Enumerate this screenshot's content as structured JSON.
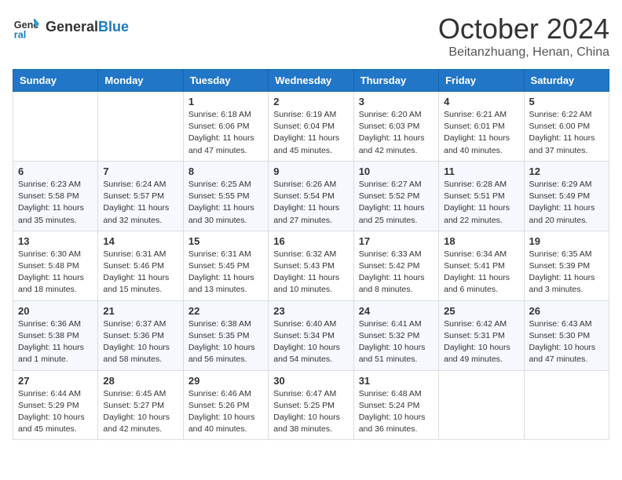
{
  "header": {
    "logo_general": "General",
    "logo_blue": "Blue",
    "month_title": "October 2024",
    "location": "Beitanzhuang, Henan, China"
  },
  "weekdays": [
    "Sunday",
    "Monday",
    "Tuesday",
    "Wednesday",
    "Thursday",
    "Friday",
    "Saturday"
  ],
  "weeks": [
    [
      {
        "day": "",
        "info": ""
      },
      {
        "day": "",
        "info": ""
      },
      {
        "day": "1",
        "info": "Sunrise: 6:18 AM\nSunset: 6:06 PM\nDaylight: 11 hours and 47 minutes."
      },
      {
        "day": "2",
        "info": "Sunrise: 6:19 AM\nSunset: 6:04 PM\nDaylight: 11 hours and 45 minutes."
      },
      {
        "day": "3",
        "info": "Sunrise: 6:20 AM\nSunset: 6:03 PM\nDaylight: 11 hours and 42 minutes."
      },
      {
        "day": "4",
        "info": "Sunrise: 6:21 AM\nSunset: 6:01 PM\nDaylight: 11 hours and 40 minutes."
      },
      {
        "day": "5",
        "info": "Sunrise: 6:22 AM\nSunset: 6:00 PM\nDaylight: 11 hours and 37 minutes."
      }
    ],
    [
      {
        "day": "6",
        "info": "Sunrise: 6:23 AM\nSunset: 5:58 PM\nDaylight: 11 hours and 35 minutes."
      },
      {
        "day": "7",
        "info": "Sunrise: 6:24 AM\nSunset: 5:57 PM\nDaylight: 11 hours and 32 minutes."
      },
      {
        "day": "8",
        "info": "Sunrise: 6:25 AM\nSunset: 5:55 PM\nDaylight: 11 hours and 30 minutes."
      },
      {
        "day": "9",
        "info": "Sunrise: 6:26 AM\nSunset: 5:54 PM\nDaylight: 11 hours and 27 minutes."
      },
      {
        "day": "10",
        "info": "Sunrise: 6:27 AM\nSunset: 5:52 PM\nDaylight: 11 hours and 25 minutes."
      },
      {
        "day": "11",
        "info": "Sunrise: 6:28 AM\nSunset: 5:51 PM\nDaylight: 11 hours and 22 minutes."
      },
      {
        "day": "12",
        "info": "Sunrise: 6:29 AM\nSunset: 5:49 PM\nDaylight: 11 hours and 20 minutes."
      }
    ],
    [
      {
        "day": "13",
        "info": "Sunrise: 6:30 AM\nSunset: 5:48 PM\nDaylight: 11 hours and 18 minutes."
      },
      {
        "day": "14",
        "info": "Sunrise: 6:31 AM\nSunset: 5:46 PM\nDaylight: 11 hours and 15 minutes."
      },
      {
        "day": "15",
        "info": "Sunrise: 6:31 AM\nSunset: 5:45 PM\nDaylight: 11 hours and 13 minutes."
      },
      {
        "day": "16",
        "info": "Sunrise: 6:32 AM\nSunset: 5:43 PM\nDaylight: 11 hours and 10 minutes."
      },
      {
        "day": "17",
        "info": "Sunrise: 6:33 AM\nSunset: 5:42 PM\nDaylight: 11 hours and 8 minutes."
      },
      {
        "day": "18",
        "info": "Sunrise: 6:34 AM\nSunset: 5:41 PM\nDaylight: 11 hours and 6 minutes."
      },
      {
        "day": "19",
        "info": "Sunrise: 6:35 AM\nSunset: 5:39 PM\nDaylight: 11 hours and 3 minutes."
      }
    ],
    [
      {
        "day": "20",
        "info": "Sunrise: 6:36 AM\nSunset: 5:38 PM\nDaylight: 11 hours and 1 minute."
      },
      {
        "day": "21",
        "info": "Sunrise: 6:37 AM\nSunset: 5:36 PM\nDaylight: 10 hours and 58 minutes."
      },
      {
        "day": "22",
        "info": "Sunrise: 6:38 AM\nSunset: 5:35 PM\nDaylight: 10 hours and 56 minutes."
      },
      {
        "day": "23",
        "info": "Sunrise: 6:40 AM\nSunset: 5:34 PM\nDaylight: 10 hours and 54 minutes."
      },
      {
        "day": "24",
        "info": "Sunrise: 6:41 AM\nSunset: 5:32 PM\nDaylight: 10 hours and 51 minutes."
      },
      {
        "day": "25",
        "info": "Sunrise: 6:42 AM\nSunset: 5:31 PM\nDaylight: 10 hours and 49 minutes."
      },
      {
        "day": "26",
        "info": "Sunrise: 6:43 AM\nSunset: 5:30 PM\nDaylight: 10 hours and 47 minutes."
      }
    ],
    [
      {
        "day": "27",
        "info": "Sunrise: 6:44 AM\nSunset: 5:29 PM\nDaylight: 10 hours and 45 minutes."
      },
      {
        "day": "28",
        "info": "Sunrise: 6:45 AM\nSunset: 5:27 PM\nDaylight: 10 hours and 42 minutes."
      },
      {
        "day": "29",
        "info": "Sunrise: 6:46 AM\nSunset: 5:26 PM\nDaylight: 10 hours and 40 minutes."
      },
      {
        "day": "30",
        "info": "Sunrise: 6:47 AM\nSunset: 5:25 PM\nDaylight: 10 hours and 38 minutes."
      },
      {
        "day": "31",
        "info": "Sunrise: 6:48 AM\nSunset: 5:24 PM\nDaylight: 10 hours and 36 minutes."
      },
      {
        "day": "",
        "info": ""
      },
      {
        "day": "",
        "info": ""
      }
    ]
  ]
}
